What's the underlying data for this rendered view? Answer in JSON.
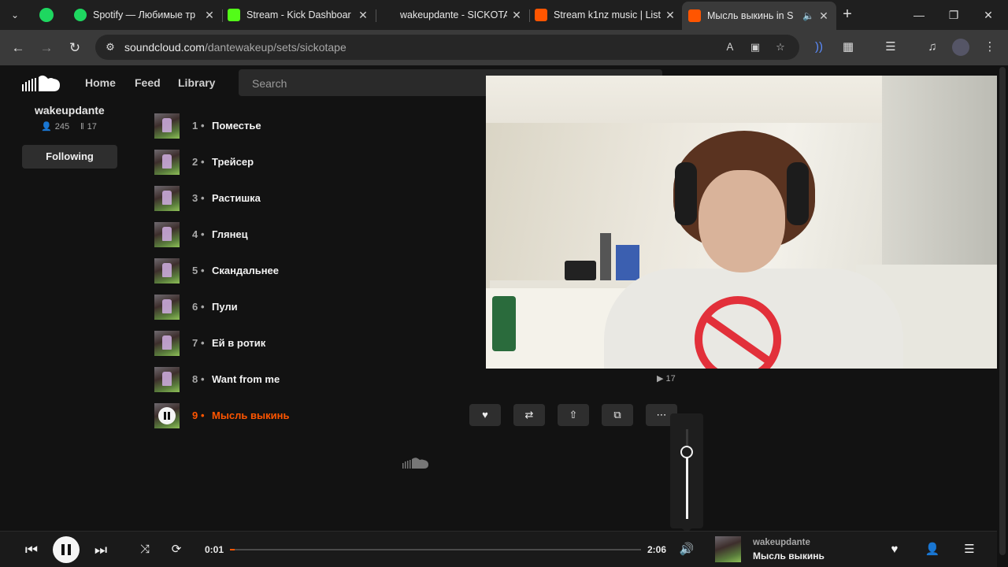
{
  "browser": {
    "tabs": [
      {
        "title": "Spotify — Любимые тр",
        "favicon": "spotify-icon"
      },
      {
        "title": "Stream - Kick Dashboar",
        "favicon": "kick-icon"
      },
      {
        "title": "wakeupdante - SICKOTA",
        "favicon": "none"
      },
      {
        "title": "Stream k1nz music | List",
        "favicon": "soundcloud-icon"
      },
      {
        "title": "Мысль выкинь in S",
        "favicon": "soundcloud-icon",
        "active": true
      }
    ],
    "url_host": "soundcloud.com",
    "url_path": "/dantewakeup/sets/sickotape"
  },
  "header": {
    "nav": [
      "Home",
      "Feed",
      "Library"
    ],
    "search_placeholder": "Search"
  },
  "profile": {
    "name": "wakeupdante",
    "followers": "245",
    "tracks": "17",
    "following_label": "Following"
  },
  "tracklist": [
    {
      "num": "1",
      "title": "Поместье"
    },
    {
      "num": "2",
      "title": "Трейсер"
    },
    {
      "num": "3",
      "title": "Растишка"
    },
    {
      "num": "4",
      "title": "Глянец"
    },
    {
      "num": "5",
      "title": "Скандальнее"
    },
    {
      "num": "6",
      "title": "Пули"
    },
    {
      "num": "7",
      "title": "Ей в ротик"
    },
    {
      "num": "8",
      "title": "Want from me"
    },
    {
      "num": "9",
      "title": "Мысль выкинь",
      "playing": true
    }
  ],
  "track_stats": {
    "plays": "17"
  },
  "volume": {
    "level": 0.75
  },
  "player": {
    "current_time": "0:01",
    "duration": "2:06",
    "progress": 0.01,
    "artist": "wakeupdante",
    "title": "Мысль выкинь"
  },
  "colors": {
    "accent": "#ff5500",
    "background": "#121212"
  }
}
